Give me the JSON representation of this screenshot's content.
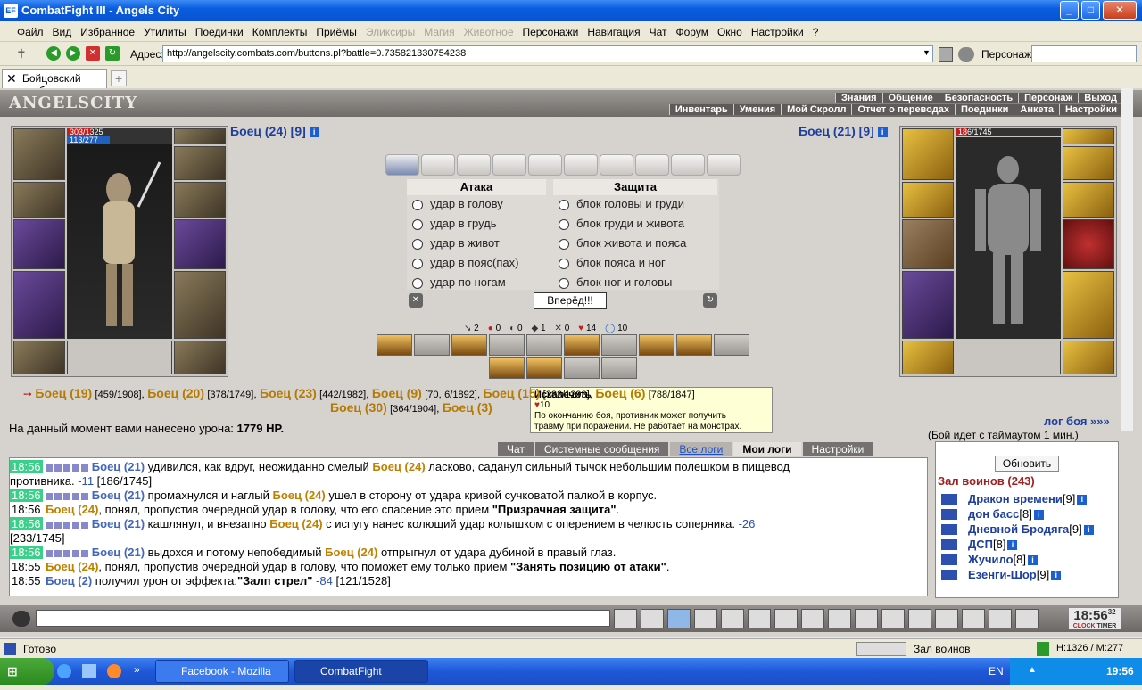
{
  "window": {
    "title": "CombatFight III - Angels City",
    "icon": "EF"
  },
  "menu": [
    {
      "label": "Файл",
      "disabled": false
    },
    {
      "label": "Вид",
      "disabled": false
    },
    {
      "label": "Избранное",
      "disabled": false
    },
    {
      "label": "Утилиты",
      "disabled": false
    },
    {
      "label": "Поединки",
      "disabled": false
    },
    {
      "label": "Комплекты",
      "disabled": false
    },
    {
      "label": "Приёмы",
      "disabled": false
    },
    {
      "label": "Эликсиры",
      "disabled": true
    },
    {
      "label": "Магия",
      "disabled": true
    },
    {
      "label": "Животное",
      "disabled": true
    },
    {
      "label": "Персонажи",
      "disabled": false
    },
    {
      "label": "Навигация",
      "disabled": false
    },
    {
      "label": "Чат",
      "disabled": false
    },
    {
      "label": "Форум",
      "disabled": false
    },
    {
      "label": "Окно",
      "disabled": false
    },
    {
      "label": "Настройки",
      "disabled": false
    },
    {
      "label": "?",
      "disabled": false
    }
  ],
  "address": {
    "label": "Адрес:",
    "url": "http://angelscity.combats.com/buttons.pl?battle=0.735821330754238",
    "persona_label": "Персонаж:"
  },
  "tab": {
    "label": "Бойцовский клуб"
  },
  "header": {
    "logo": "ANGELSCITY",
    "nav_top": [
      "Знания",
      "Общение",
      "Безопасность",
      "Персонаж",
      "Выход"
    ],
    "nav_bottom": [
      "Инвентарь",
      "Умения",
      "Мой Скролл",
      "Отчет о переводах",
      "Поединки",
      "Анкета",
      "Настройки"
    ]
  },
  "player": {
    "hp": "303/1325",
    "mana": "113/277",
    "name": "Боец (24) [9]",
    "hp_fill": 0.23,
    "mana_fill": 0.41
  },
  "opponent": {
    "hp": "186/1745",
    "name": "Боец (21) [9]",
    "hp_fill": 0.11
  },
  "battle": {
    "attack_title": "Атака",
    "defense_title": "Защита",
    "attacks": [
      "удар в голову",
      "удар в грудь",
      "удар в живот",
      "удар в пояс(пах)",
      "удар по ногам"
    ],
    "defenses": [
      "блок головы и груди",
      "блок груди и живота",
      "блок живота и пояса",
      "блок пояса и ног",
      "блок ног и головы"
    ],
    "go_button": "Вперёд!!!",
    "stats": [
      "2",
      "0",
      "0",
      "1",
      "0",
      "14",
      "10"
    ]
  },
  "tooltip": {
    "title": "Искалечить",
    "value": "10",
    "text1": "По окончанию боя, противник может получить",
    "text2": "травму при поражении. Не работает на монстрах."
  },
  "enemies_line1": [
    {
      "name": "Боец (19)",
      "hp": "[459/1908]"
    },
    {
      "name": "Боец (20)",
      "hp": "[378/1749]"
    },
    {
      "name": "Боец (23)",
      "hp": "[442/1982]"
    },
    {
      "name": "Боец (9)",
      "hp": "[70"
    },
    {
      "name": "",
      "hp": "6/1892]"
    },
    {
      "name": "Боец (15)",
      "hp": "[388/1293]"
    },
    {
      "name": "Боец (6)",
      "hp": "[788/1847]"
    }
  ],
  "enemies_line2": [
    {
      "name": "Боец (30)",
      "hp": "[364/1904]"
    },
    {
      "name": "Боец (3)",
      "hp": ""
    }
  ],
  "damage": {
    "label": "На данный момент вами нанесено урона:",
    "value": "1779 HP."
  },
  "log_link": "лог боя »»»",
  "timeout": "(Бой идет с таймаутом 1 мин.)",
  "log_tabs": [
    {
      "label": "Чат",
      "style": "normal"
    },
    {
      "label": "Системные сообщения",
      "style": "normal"
    },
    {
      "label": "Все логи",
      "style": "blue"
    },
    {
      "label": "Мои логи",
      "style": "act"
    },
    {
      "label": "Настройки",
      "style": "normal"
    }
  ],
  "log": [
    {
      "time": "18:56",
      "hl": true,
      "parts": [
        [
          "b1",
          "Боец (21)"
        ],
        [
          "t",
          " удивился, как вдруг, неожиданно смелый "
        ],
        [
          "b2",
          "Боец (24)"
        ],
        [
          "t",
          " ласково, саданул сильный тычок небольшим полешком в пищевод"
        ]
      ]
    },
    {
      "time": "",
      "hl": false,
      "parts": [
        [
          "t",
          "противника. "
        ],
        [
          "dmg",
          "-11"
        ],
        [
          "t",
          " [186/1745]"
        ]
      ]
    },
    {
      "time": "18:56",
      "hl": true,
      "parts": [
        [
          "b1",
          "Боец (21)"
        ],
        [
          "t",
          " промахнулся и наглый "
        ],
        [
          "b2",
          "Боец (24)"
        ],
        [
          "t",
          " ушел в сторону от удара кривой сучковатой палкой в корпус."
        ]
      ]
    },
    {
      "time": "18:56",
      "hl": false,
      "parts": [
        [
          "b2",
          "Боец (24)"
        ],
        [
          "t",
          ", понял, пропустив очередной удар в голову, что его спасение это прием "
        ],
        [
          "bold",
          "\"Призрачная защита\""
        ],
        [
          "t",
          "."
        ]
      ]
    },
    {
      "time": "18:56",
      "hl": true,
      "parts": [
        [
          "b1",
          "Боец (21)"
        ],
        [
          "t",
          " кашлянул, и внезапно "
        ],
        [
          "b2",
          "Боец (24)"
        ],
        [
          "t",
          " с испугу нанес колющий удар колышком с оперением в челюсть соперника. "
        ],
        [
          "dmg",
          "-26"
        ]
      ]
    },
    {
      "time": "",
      "hl": false,
      "parts": [
        [
          "t",
          "[233/1745]"
        ]
      ]
    },
    {
      "time": "18:56",
      "hl": true,
      "parts": [
        [
          "b1",
          "Боец (21)"
        ],
        [
          "t",
          " выдохся и потому непобедимый "
        ],
        [
          "b2",
          "Боец (24)"
        ],
        [
          "t",
          " отпрыгнул от удара дубиной в правый глаз."
        ]
      ]
    },
    {
      "time": "18:55",
      "hl": false,
      "parts": [
        [
          "b2",
          "Боец (24)"
        ],
        [
          "t",
          ", понял, пропустив очередной удар в голову, что поможет ему только прием "
        ],
        [
          "bold",
          "\"Занять позицию от атаки\""
        ],
        [
          "t",
          "."
        ]
      ]
    },
    {
      "time": "18:55",
      "hl": false,
      "parts": [
        [
          "b1",
          "Боец (2)"
        ],
        [
          "t",
          " получил урон от эффекта:"
        ],
        [
          "bold",
          "\"Залп стрел\""
        ],
        [
          "t",
          " "
        ],
        [
          "dmg",
          "-84"
        ],
        [
          "t",
          " [121/1528]"
        ]
      ]
    }
  ],
  "right_panel": {
    "refresh": "Обновить",
    "hall": "Зал воинов (243)",
    "people": [
      {
        "name": "Дракон времени",
        "lvl": "[9]"
      },
      {
        "name": "дон басс",
        "lvl": "[8]"
      },
      {
        "name": "Дневной Бродяга",
        "lvl": "[9]"
      },
      {
        "name": "ДСП",
        "lvl": "[8]"
      },
      {
        "name": "Жучило",
        "lvl": "[8]"
      },
      {
        "name": "Езенги-Шор",
        "lvl": "[9]"
      }
    ]
  },
  "clock": {
    "time": "18:56",
    "sec": "32",
    "label1": "CLOCK",
    "label2": "TIMER"
  },
  "statusbar": {
    "status": "Готово",
    "location": "Зал воинов",
    "hp": "H:1326 / M:277"
  },
  "taskbar": {
    "start": "пуск",
    "tasks": [
      {
        "label": "Facebook - Mozilla ...",
        "active": false
      },
      {
        "label": "CombatFight",
        "active": true
      }
    ],
    "lang": "EN",
    "time": "19:56"
  }
}
